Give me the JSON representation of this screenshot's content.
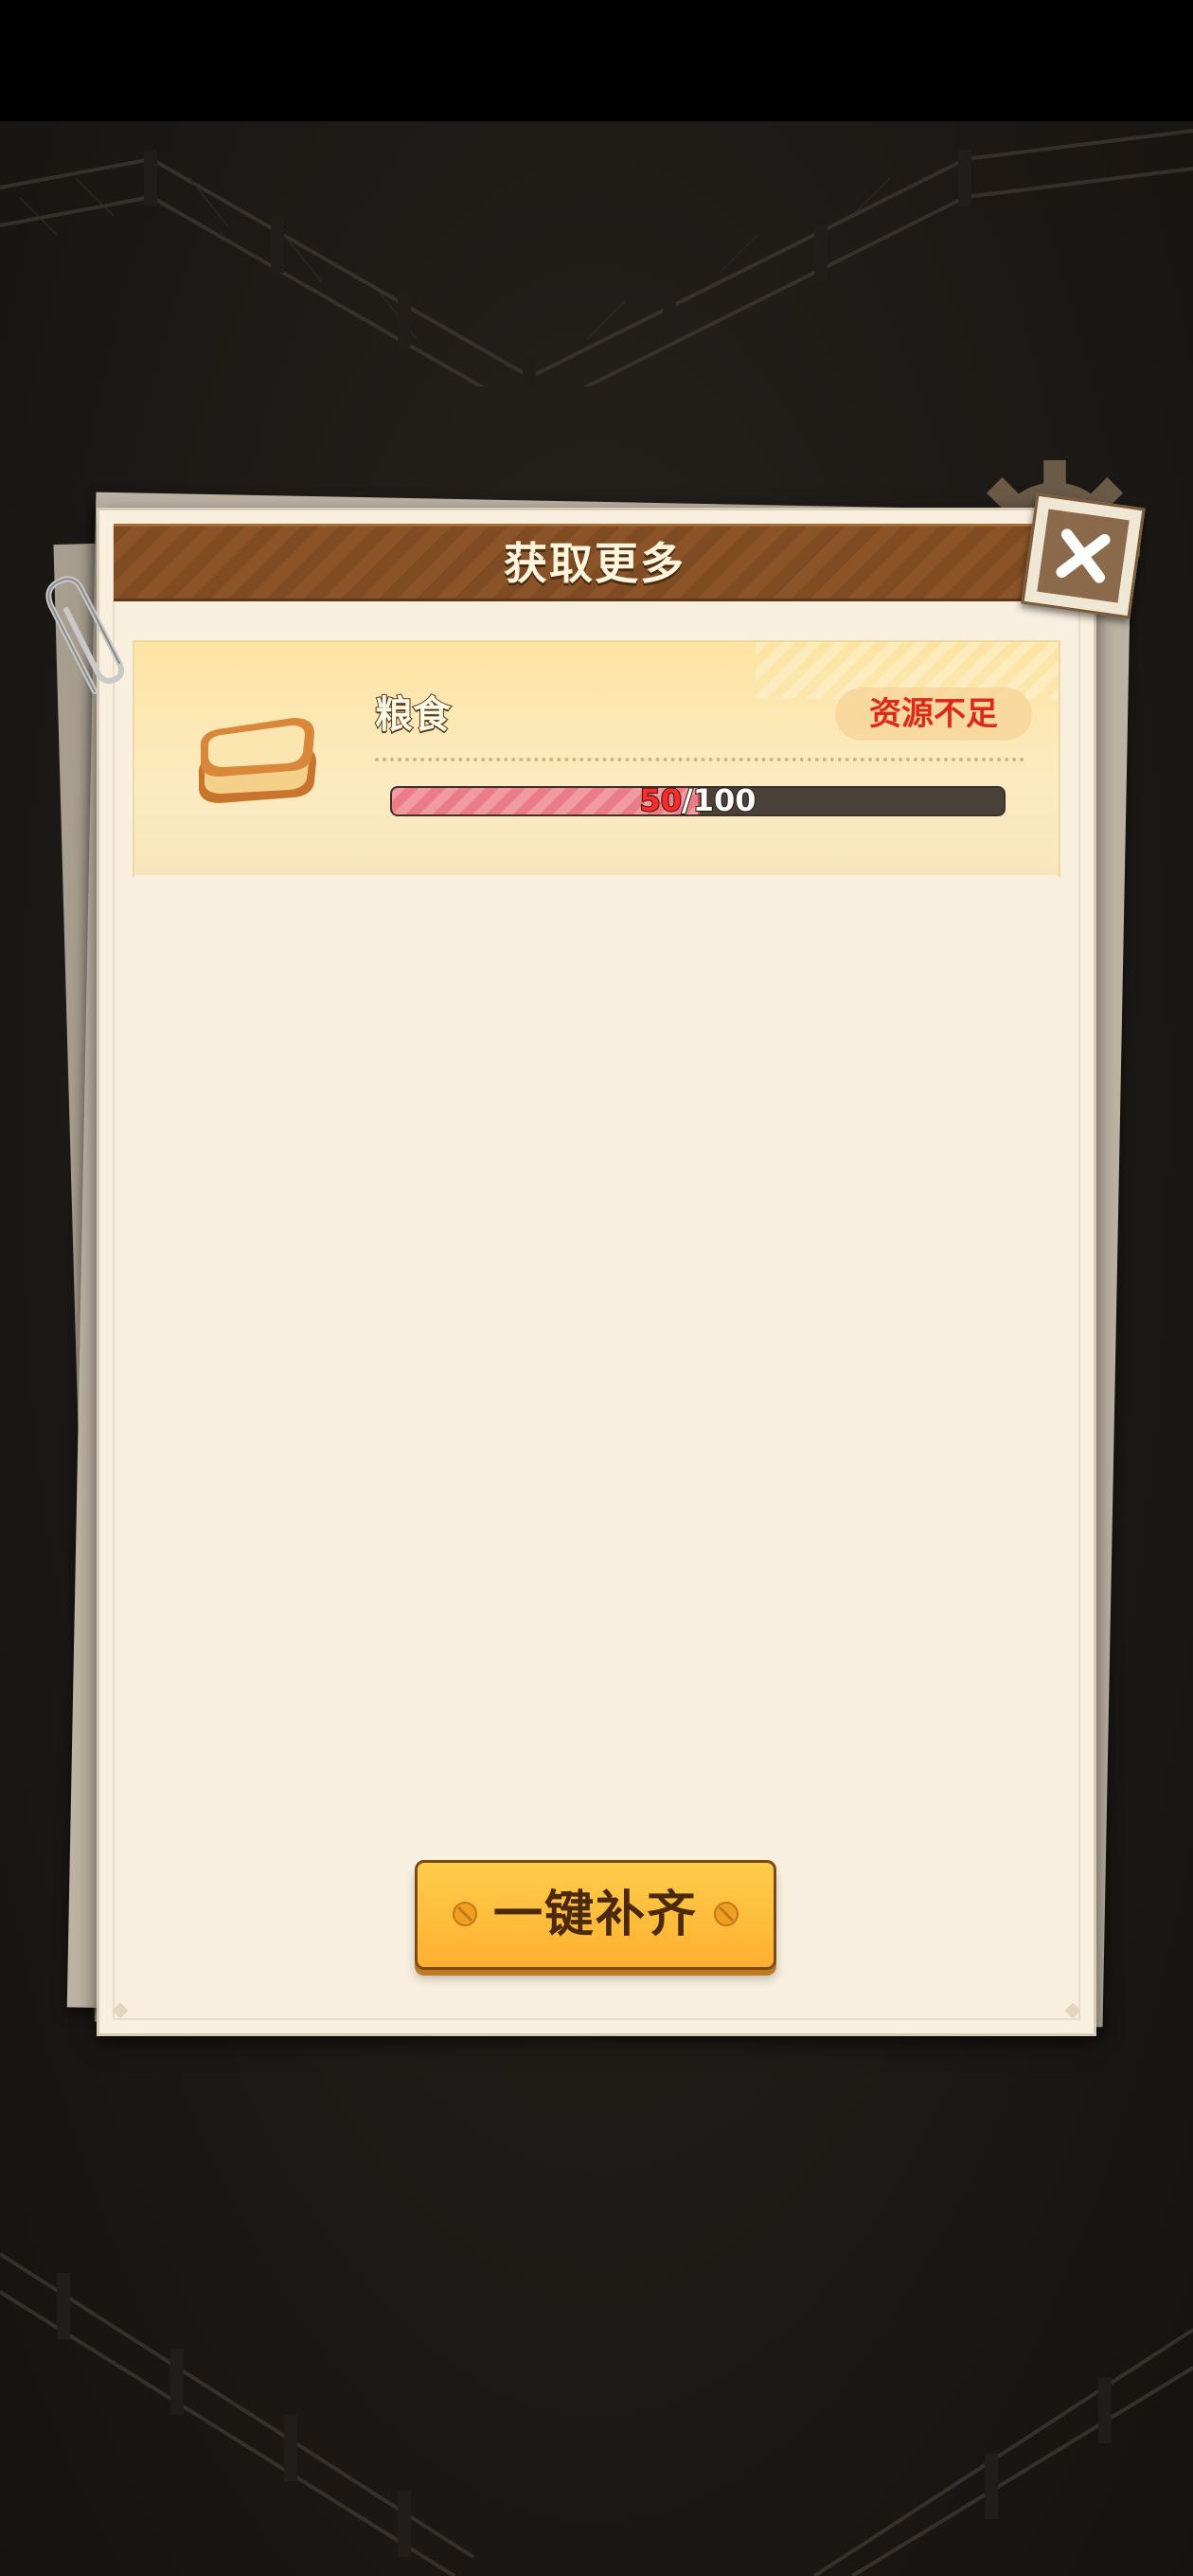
{
  "header": {
    "title": "获取更多"
  },
  "item": {
    "name": "粮食",
    "status": "资源不足",
    "icon": "bread-icon",
    "progress": {
      "current": "50",
      "separator": "/",
      "max": "100",
      "fraction": 0.5
    }
  },
  "actions": {
    "fill_all_label": "一键补齐"
  },
  "colors": {
    "accent": "#ffb030",
    "header": "#7e4b22",
    "warning": "#e0281a"
  }
}
